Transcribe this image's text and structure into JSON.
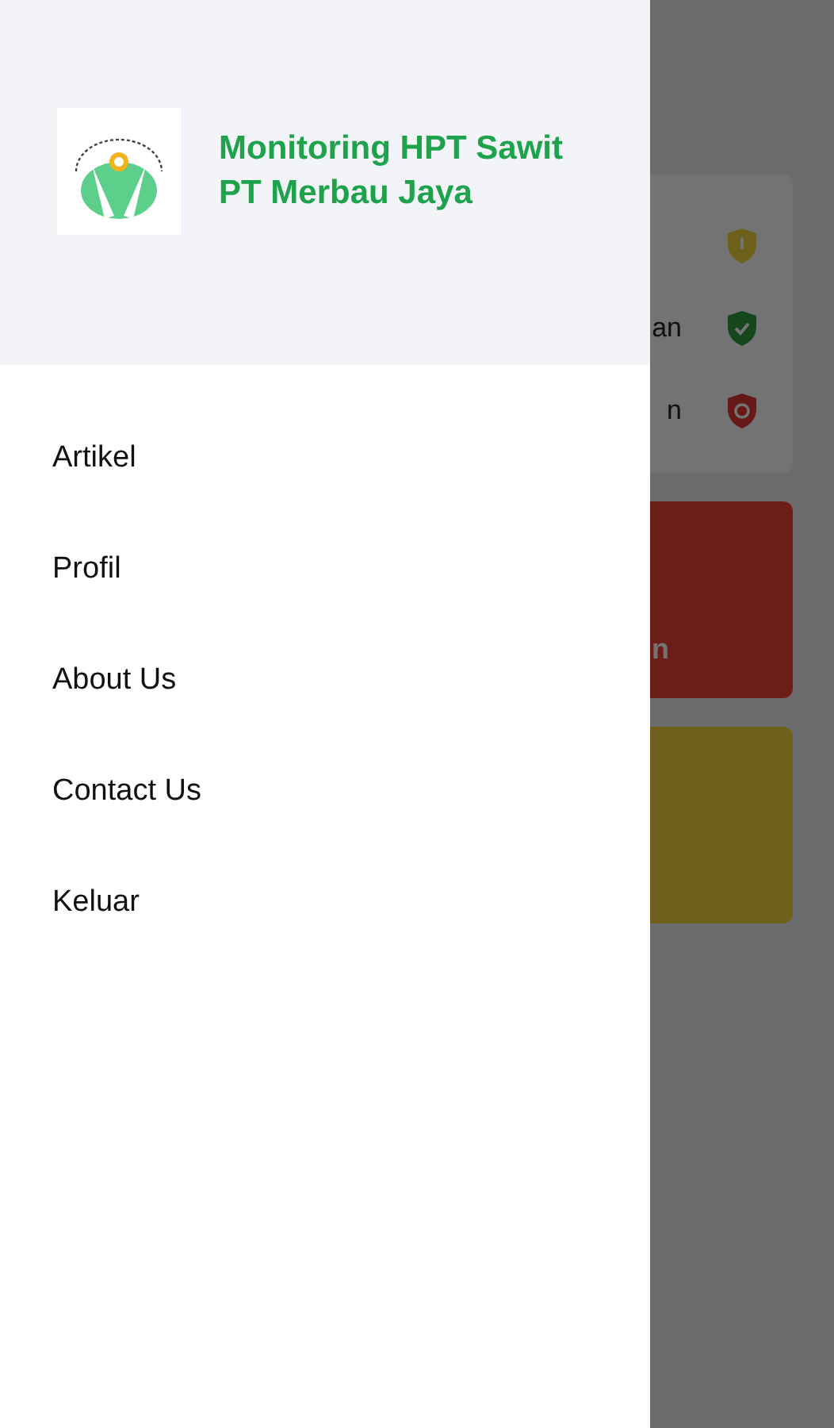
{
  "drawer": {
    "header": {
      "title_lines": [
        "Monitoring HPT Sawit",
        "PT Merbau Jaya"
      ]
    },
    "menu": [
      {
        "label": "Artikel"
      },
      {
        "label": "Profil"
      },
      {
        "label": "About Us"
      },
      {
        "label": "Contact Us"
      },
      {
        "label": "Keluar"
      }
    ]
  },
  "background": {
    "status_rows": [
      {
        "kind": "warning"
      },
      {
        "kind": "ok",
        "text": "an"
      },
      {
        "kind": "blocked",
        "text": "n"
      }
    ],
    "tiles": [
      {
        "kind": "red",
        "text": "n"
      },
      {
        "kind": "yellow"
      }
    ]
  }
}
